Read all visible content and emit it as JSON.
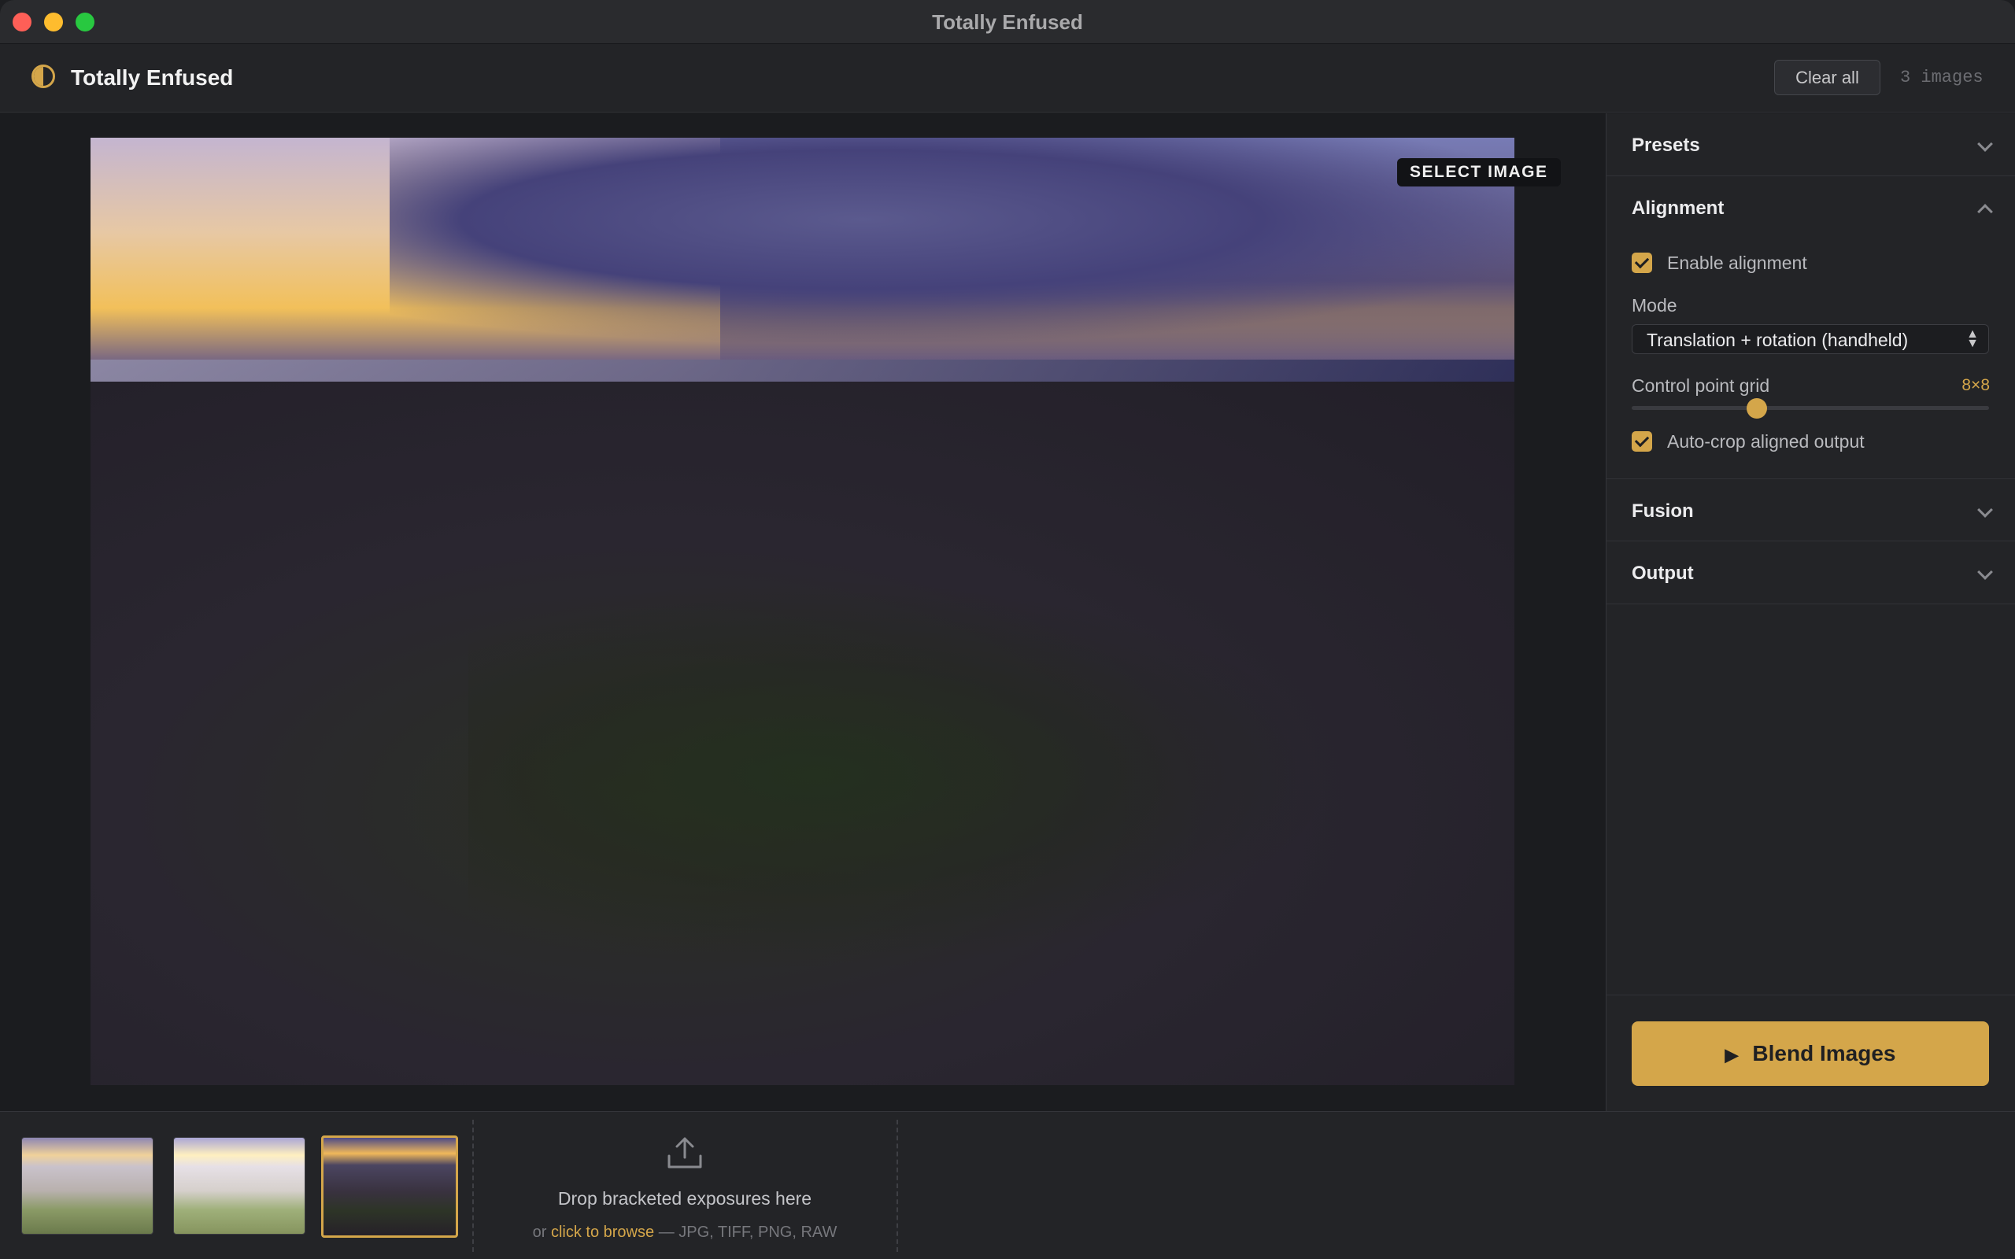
{
  "window": {
    "title": "Totally Enfused"
  },
  "header": {
    "app_name": "Totally Enfused",
    "clear_label": "Clear all",
    "image_count": "3 images"
  },
  "viewer": {
    "badge": "SELECT IMAGE"
  },
  "panel": {
    "presets": {
      "label": "Presets",
      "expanded": false
    },
    "alignment": {
      "label": "Alignment",
      "expanded": true,
      "enable_label": "Enable alignment",
      "enable_checked": true,
      "mode_label": "Mode",
      "mode_value": "Translation + rotation (handheld)",
      "grid_label": "Control point grid",
      "grid_value": "8×8",
      "grid_slider_fraction": 0.35,
      "autocrop_label": "Auto-crop aligned output",
      "autocrop_checked": true
    },
    "fusion": {
      "label": "Fusion",
      "expanded": false
    },
    "output": {
      "label": "Output",
      "expanded": false
    },
    "blend_label": "Blend Images"
  },
  "filmstrip": {
    "thumbnails": [
      {
        "name": "exposure-1",
        "selected": false
      },
      {
        "name": "exposure-2",
        "selected": false
      },
      {
        "name": "exposure-3",
        "selected": true
      }
    ],
    "drop_title": "Drop bracketed exposures here",
    "drop_prefix": "or",
    "drop_link": "click to browse",
    "drop_suffix": "— JPG, TIFF, PNG, RAW"
  },
  "colors": {
    "accent": "#d4a64a",
    "background": "#1d1e21",
    "panel": "#232427"
  }
}
